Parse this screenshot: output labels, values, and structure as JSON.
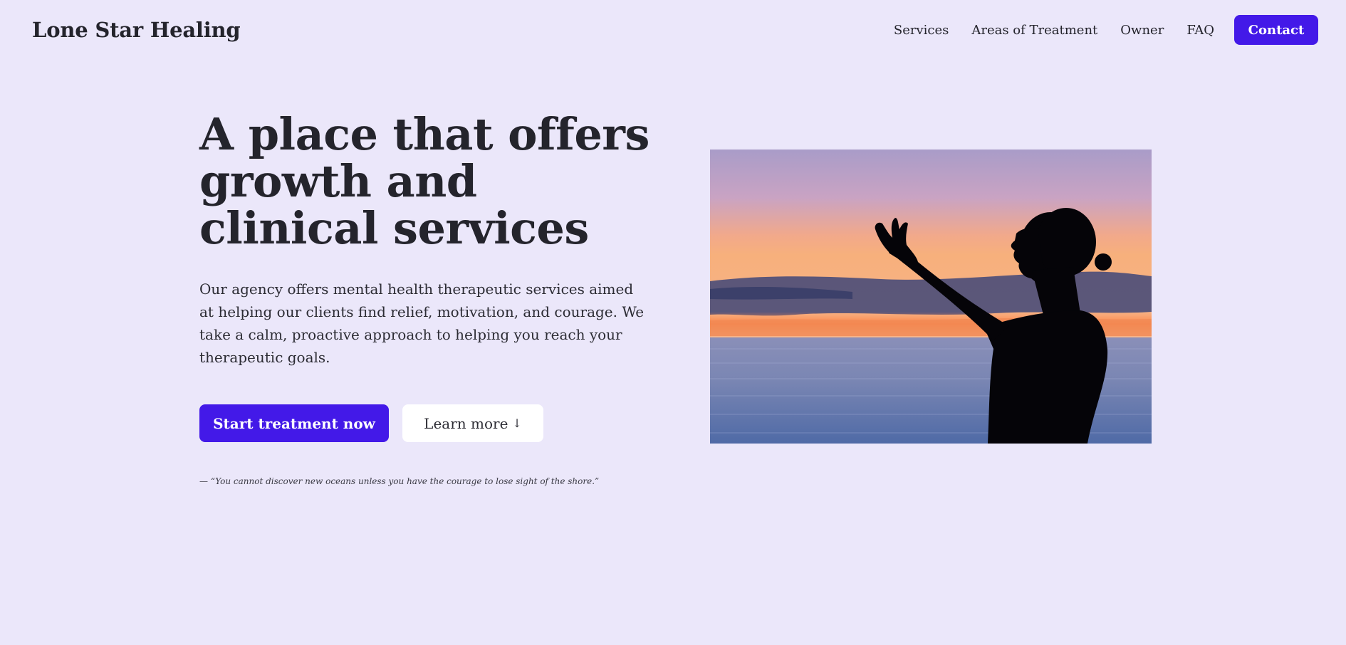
{
  "brand": {
    "name": "Lone Star Healing"
  },
  "nav": {
    "items": [
      {
        "label": "Services"
      },
      {
        "label": "Areas of Treatment"
      },
      {
        "label": "Owner"
      },
      {
        "label": "FAQ"
      }
    ],
    "contact_label": "Contact"
  },
  "hero": {
    "title": "A place that offers growth and clinical services",
    "description": "Our agency offers mental health therapeutic services aimed at helping our clients find relief, motivation, and courage. We take a calm, proactive approach to helping you reach your therapeutic goals.",
    "primary_cta": "Start treatment now",
    "secondary_cta": "Learn more",
    "secondary_cta_icon": "arrow-down-icon",
    "quote": "— “You cannot discover new oceans unless you have the courage to lose sight of the shore.”"
  },
  "colors": {
    "background": "#ebe7fa",
    "accent": "#4319e8",
    "text": "#24242c",
    "secondary_button_bg": "#ffffff"
  },
  "image": {
    "subject": "silhouette of a woman with raised arm against a sunset over the sea"
  }
}
